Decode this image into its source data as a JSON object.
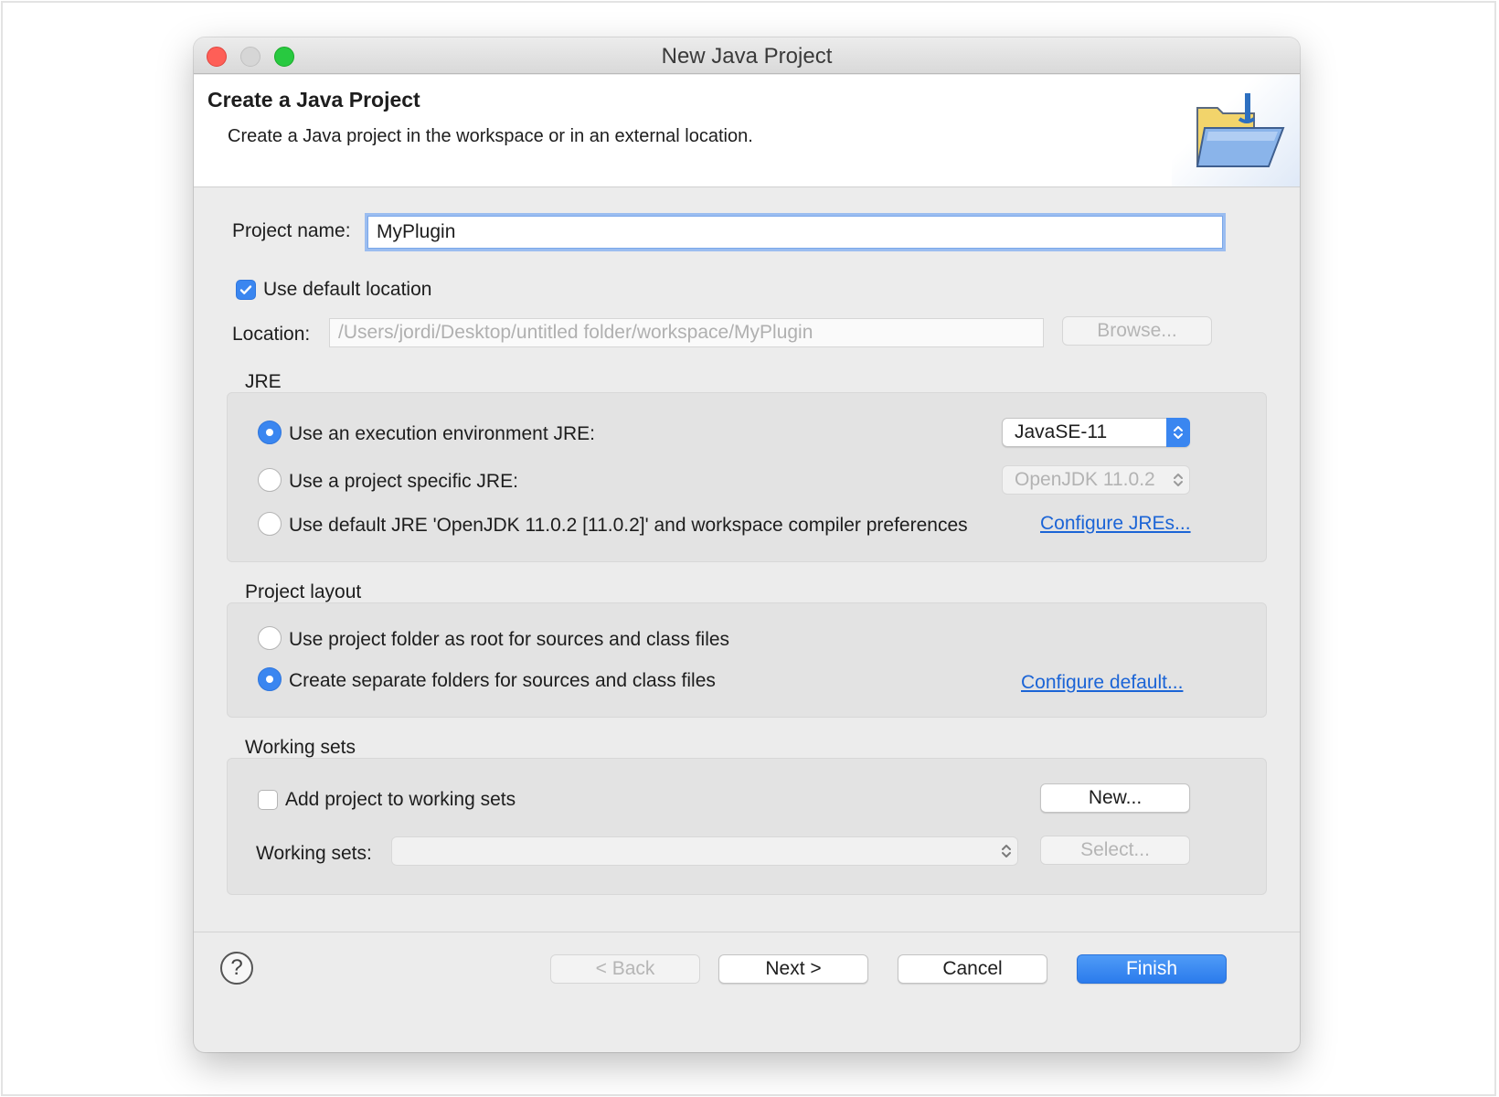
{
  "window": {
    "title": "New Java Project"
  },
  "banner": {
    "title": "Create a Java Project",
    "description": "Create a Java project in the workspace or in an external location.",
    "icon": "java-folder-icon"
  },
  "project_name": {
    "label": "Project name:",
    "value": "MyPlugin"
  },
  "location": {
    "use_default_label": "Use default location",
    "use_default_checked": true,
    "label": "Location:",
    "value": "/Users/jordi/Desktop/untitled folder/workspace/MyPlugin",
    "browse_label": "Browse..."
  },
  "jre": {
    "title": "JRE",
    "options": [
      {
        "label": "Use an execution environment JRE:",
        "selected": true
      },
      {
        "label": "Use a project specific JRE:",
        "selected": false
      },
      {
        "label": "Use default JRE 'OpenJDK 11.0.2 [11.0.2]' and workspace compiler preferences",
        "selected": false
      }
    ],
    "execution_env_value": "JavaSE-11",
    "project_specific_value": "OpenJDK 11.0.2",
    "configure_link": "Configure JREs..."
  },
  "layout": {
    "title": "Project layout",
    "options": [
      {
        "label": "Use project folder as root for sources and class files",
        "selected": false
      },
      {
        "label": "Create separate folders for sources and class files",
        "selected": true
      }
    ],
    "configure_link": "Configure default..."
  },
  "working_sets": {
    "title": "Working sets",
    "add_label": "Add project to working sets",
    "add_checked": false,
    "new_label": "New...",
    "sets_label": "Working sets:",
    "sets_value": "",
    "select_label": "Select..."
  },
  "footer": {
    "help_icon": "help-icon",
    "back_label": "< Back",
    "next_label": "Next >",
    "cancel_label": "Cancel",
    "finish_label": "Finish"
  },
  "colors": {
    "accent": "#3a86f0",
    "link": "#1b64d6",
    "close": "#fe5f57",
    "maximize": "#28c940"
  }
}
